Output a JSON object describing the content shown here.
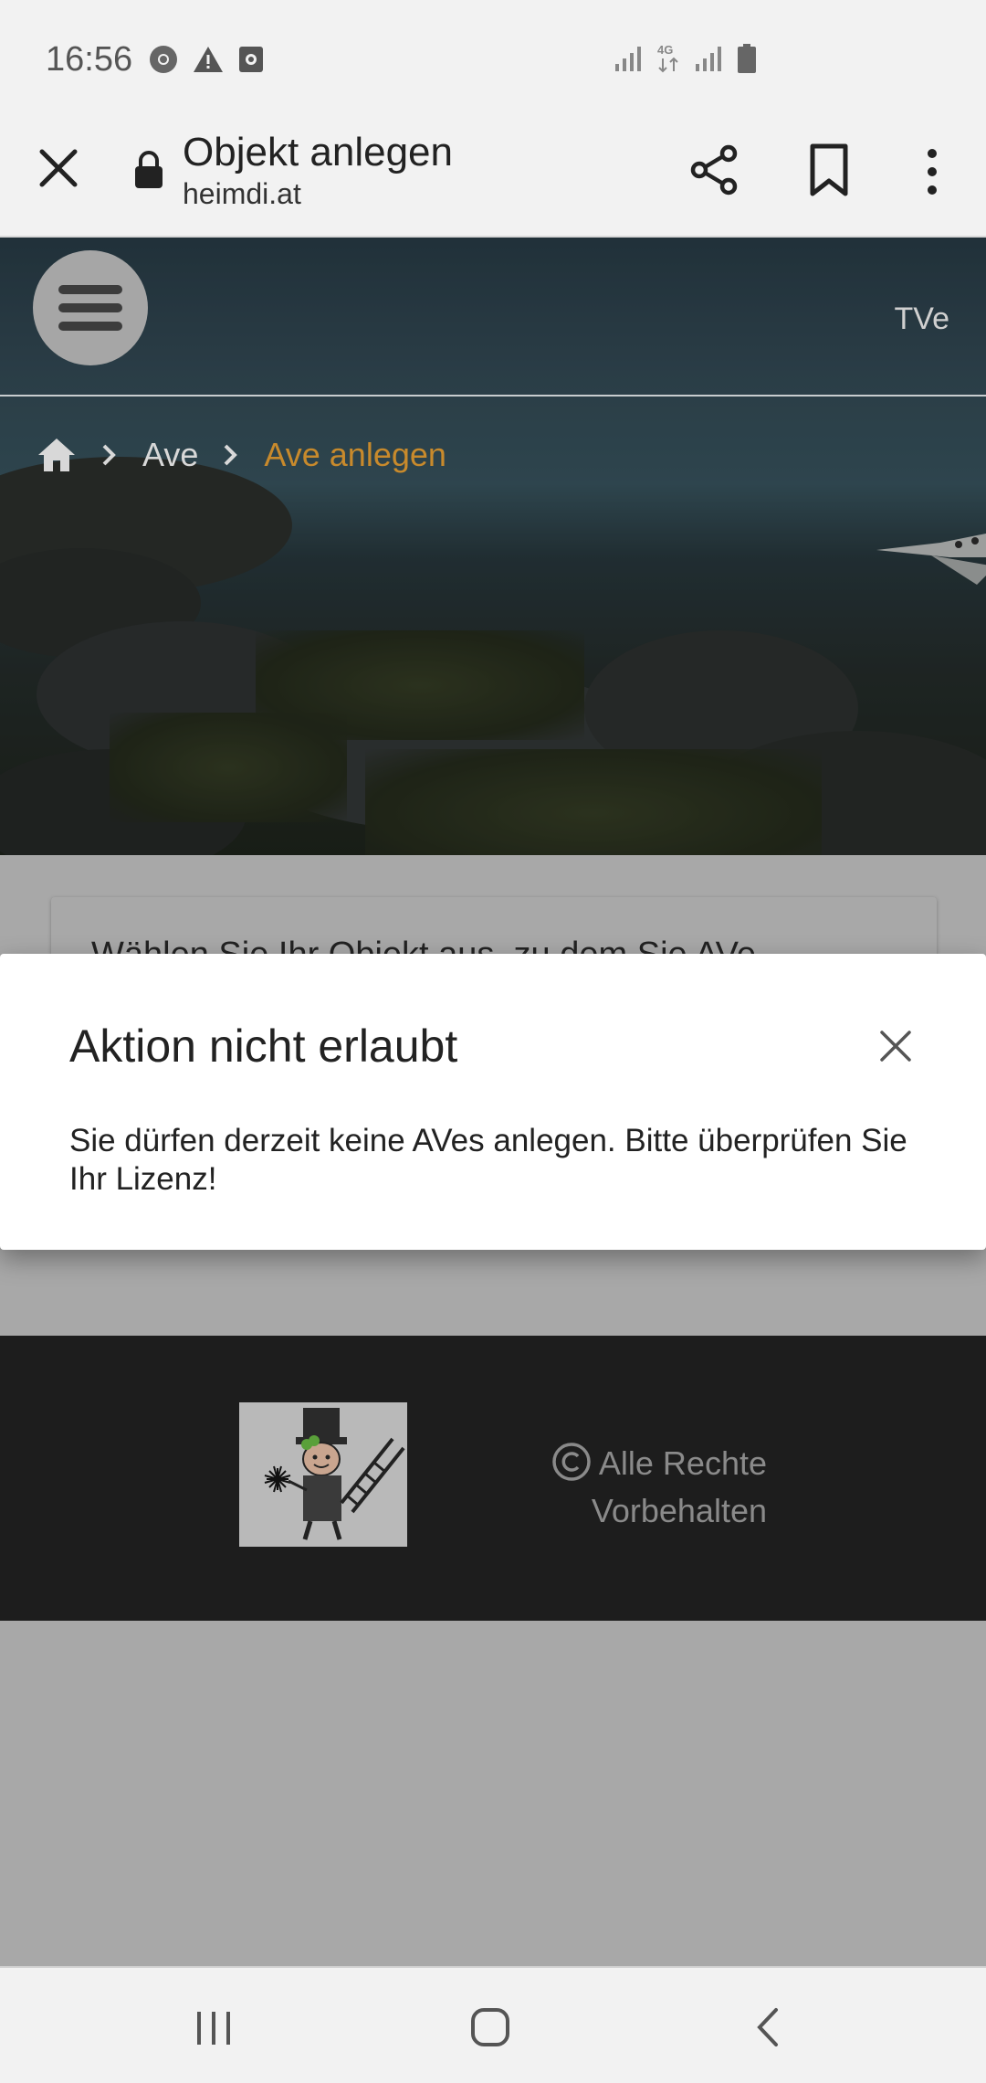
{
  "status_bar": {
    "time": "16:56",
    "left_icons": [
      "chrome-icon",
      "warning-icon",
      "screen-recorder-icon"
    ],
    "right_icons": [
      "signal-icon",
      "4g-icon",
      "signal-icon",
      "battery-icon"
    ],
    "network_label": "4G"
  },
  "browser": {
    "page_title": "Objekt anlegen",
    "url": "heimdi.at"
  },
  "header": {
    "user_label": "TVe"
  },
  "breadcrumb": {
    "items": [
      "Ave"
    ],
    "active": "Ave anlegen"
  },
  "content": {
    "card_text": "Wählen Sie Ihr Objekt aus, zu dem Sie AVe"
  },
  "modal": {
    "title": "Aktion nicht erlaubt",
    "body": "Sie dürfen derzeit keine AVes anlegen. Bitte überprüfen Sie Ihr Lizenz!"
  },
  "footer": {
    "copyright_line1": "Alle Rechte",
    "copyright_line2": "Vorbehalten"
  },
  "colors": {
    "breadcrumb_active": "#c88a2c",
    "footer_bg": "#1d1d1d",
    "scrim": "#a8a8a8"
  }
}
